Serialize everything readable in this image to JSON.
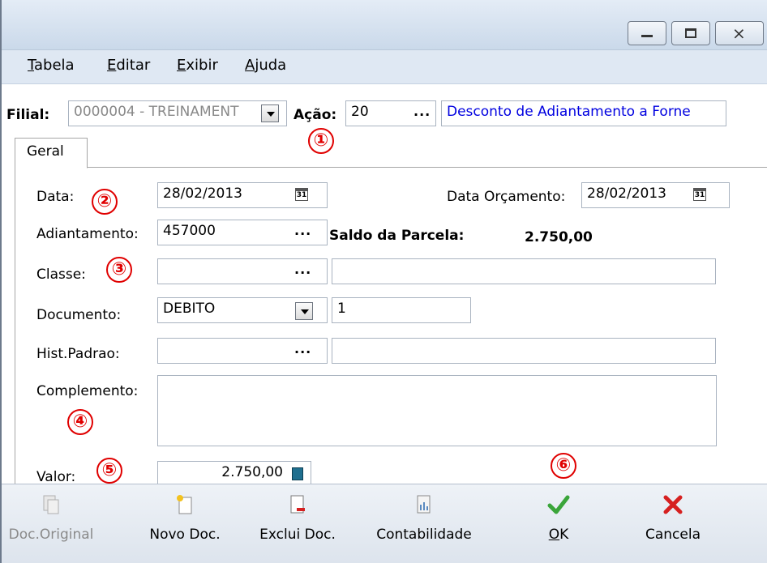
{
  "window": {
    "controls": [
      "minimize",
      "maximize",
      "close"
    ]
  },
  "menu": {
    "items": [
      {
        "first": "T",
        "rest": "abela"
      },
      {
        "first": "E",
        "rest": "ditar"
      },
      {
        "first": "E",
        "rest": "xibir"
      },
      {
        "first": "A",
        "rest": "juda"
      }
    ]
  },
  "header": {
    "filial_label": "Filial:",
    "filial_value": "0000004 - TREINAMENT",
    "acao_label": "Ação:",
    "acao_value": "20",
    "acao_desc": "Desconto de Adiantamento a Forne"
  },
  "tabs": [
    {
      "label": "Geral"
    }
  ],
  "form": {
    "data_label": "Data:",
    "data_value": "28/02/2013",
    "data_orc_label": "Data Orçamento:",
    "data_orc_value": "28/02/2013",
    "adiant_label": "Adiantamento:",
    "adiant_value": "457000",
    "saldo_label": "Saldo da Parcela:",
    "saldo_value": "2.750,00",
    "classe_label": "Classe:",
    "classe_value": "",
    "classe_desc": "",
    "documento_label": "Documento:",
    "documento_value": "DEBITO",
    "documento_num": "1",
    "hist_label": "Hist.Padrao:",
    "hist_value": "",
    "hist_desc": "",
    "complemento_label": "Complemento:",
    "complemento_value": "",
    "valor_label": "Valor:",
    "valor_value": "2.750,00",
    "ellipsis": "···"
  },
  "markers": [
    "①",
    "②",
    "③",
    "④",
    "⑤",
    "⑥"
  ],
  "toolbar": {
    "doc_original": "Doc.Original",
    "novo_doc": "Novo Doc.",
    "exclui_doc": "Exclui Doc.",
    "contabilidade": "Contabilidade",
    "ok_first": "O",
    "ok_rest": "K",
    "cancela": "Cancela"
  },
  "colors": {
    "link_blue": "#0000e0",
    "marker_red": "#e00000",
    "ok_green": "#3aa53a",
    "cancel_red": "#d62020"
  }
}
